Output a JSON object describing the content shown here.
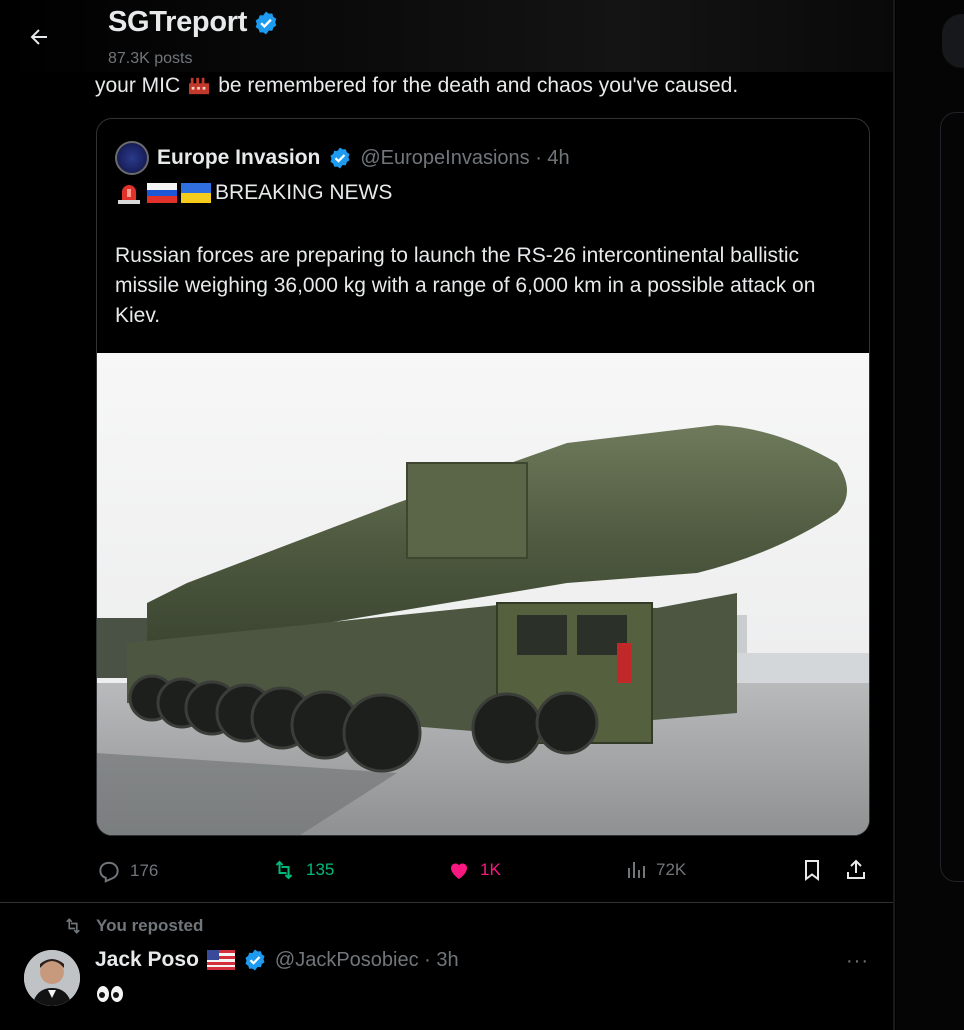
{
  "profile": {
    "name": "SGTreport",
    "posts_count": "87.3K posts"
  },
  "post": {
    "text_before": "your MIC",
    "text_after": "be remembered for the death and chaos you've caused."
  },
  "quote": {
    "name": "Europe Invasion",
    "handle": "@EuropeInvasions · 4h",
    "breaking": "BREAKING NEWS",
    "body": "Russian forces are preparing to launch the RS-26 intercontinental ballistic missile weighing 36,000 kg with a range of 6,000 km in a possible attack on Kiev."
  },
  "actions": {
    "replies": "176",
    "reposts": "135",
    "likes": "1K",
    "views": "72K"
  },
  "repost": {
    "label": "You reposted",
    "name": "Jack Poso",
    "handle": "@JackPosobiec · 3h",
    "more": "···"
  },
  "icons": {
    "back": "arrow-left-icon",
    "verified": "verified-badge-icon",
    "reply": "reply-icon",
    "retweet": "retweet-icon",
    "like": "heart-icon",
    "views": "views-bar-chart-icon",
    "bookmark": "bookmark-icon",
    "share": "share-icon"
  },
  "colors": {
    "verified": "#1d9bf0",
    "retweet": "#00ba7c",
    "like": "#f91880",
    "muted": "#71767b"
  }
}
